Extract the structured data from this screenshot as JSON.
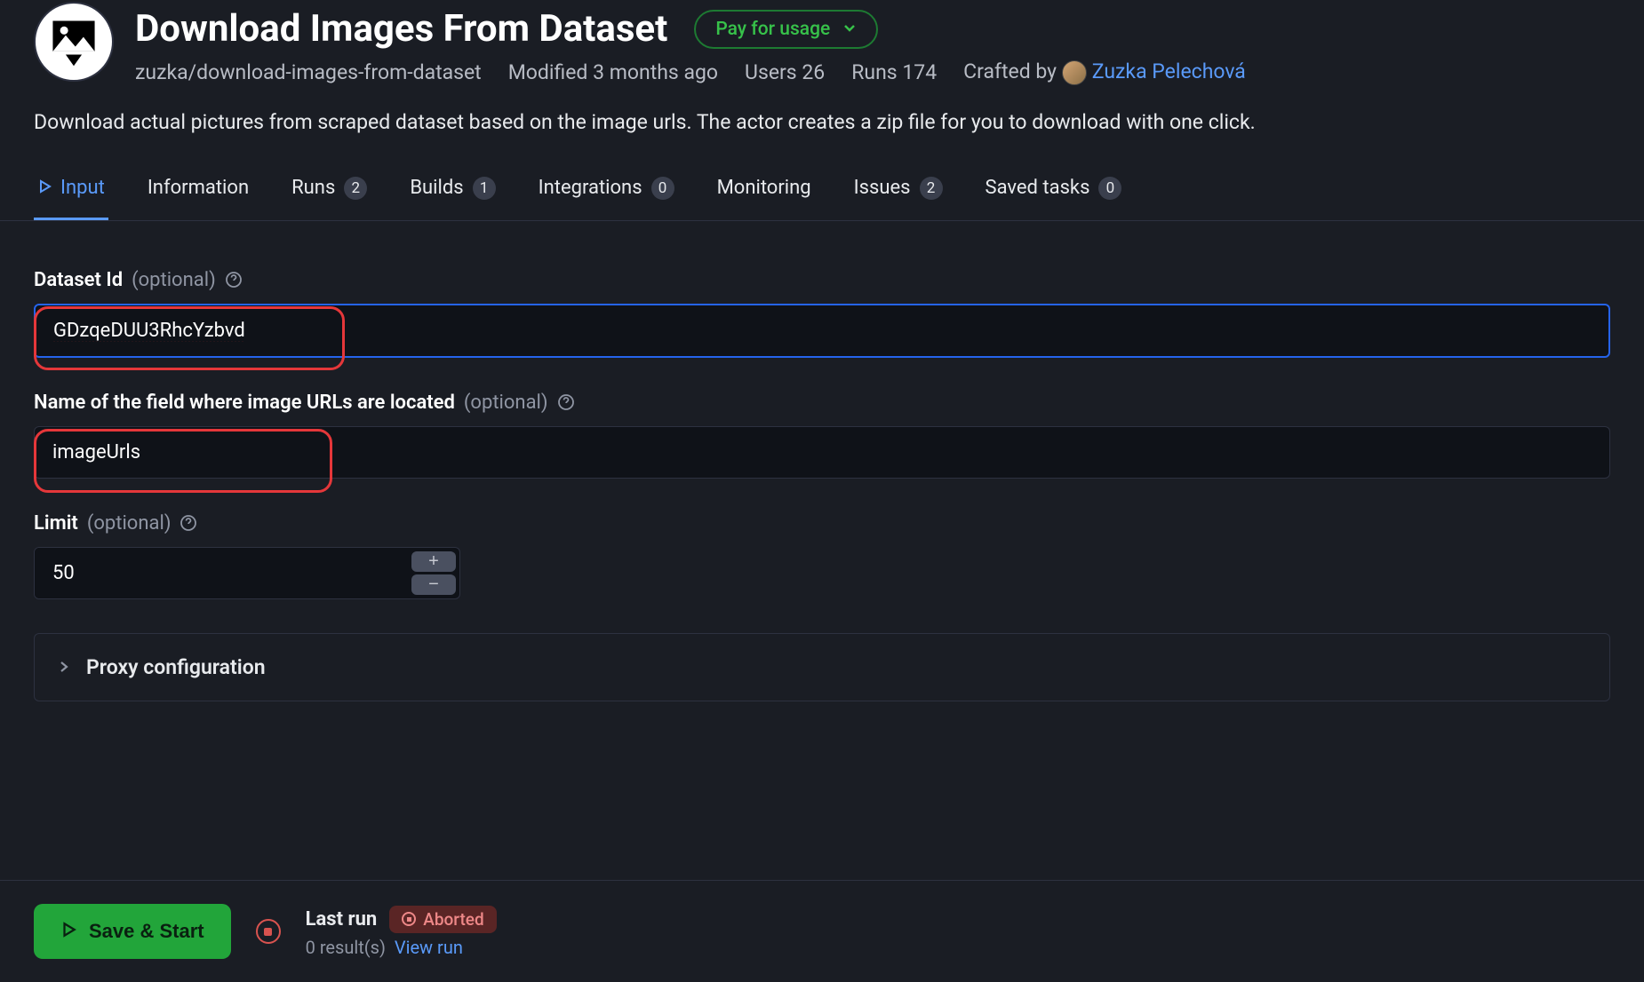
{
  "header": {
    "title": "Download Images From Dataset",
    "pay_badge": "Pay for usage",
    "slug": "zuzka/download-images-from-dataset",
    "modified": "Modified 3 months ago",
    "users": "Users 26",
    "runs": "Runs 174",
    "crafted_by_label": "Crafted by",
    "author": "Zuzka Pelechová"
  },
  "description": "Download actual pictures from scraped dataset based on the image urls. The actor creates a zip file for you to download with one click.",
  "tabs": {
    "input": "Input",
    "information": "Information",
    "runs": {
      "label": "Runs",
      "count": "2"
    },
    "builds": {
      "label": "Builds",
      "count": "1"
    },
    "integrations": {
      "label": "Integrations",
      "count": "0"
    },
    "monitoring": "Monitoring",
    "issues": {
      "label": "Issues",
      "count": "2"
    },
    "saved_tasks": {
      "label": "Saved tasks",
      "count": "0"
    }
  },
  "form": {
    "optional": "(optional)",
    "dataset": {
      "label": "Dataset Id",
      "value": "GDzqeDUU3RhcYzbvd"
    },
    "imagefield": {
      "label": "Name of the field where image URLs are located",
      "value": "imageUrls"
    },
    "limit": {
      "label": "Limit",
      "value": "50"
    },
    "proxy": "Proxy configuration"
  },
  "footer": {
    "save": "Save & Start",
    "last_run": "Last run",
    "aborted": "Aborted",
    "results": "0 result(s)",
    "view": "View run"
  }
}
